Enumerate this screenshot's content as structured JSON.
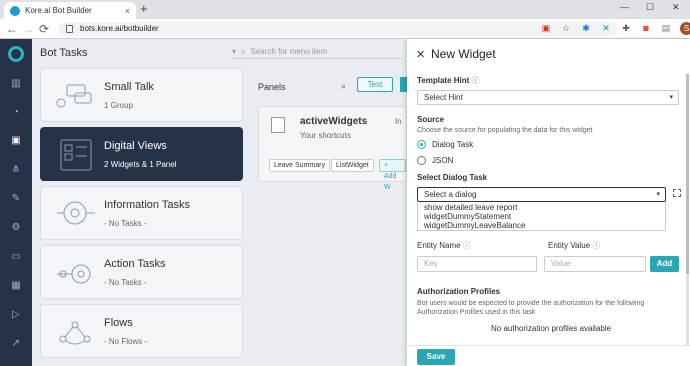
{
  "browser": {
    "tab_title": "Kore.ai Bot Builder",
    "tab_close": "×",
    "new_tab": "+",
    "url": "bots.kore.ai/botbuilder",
    "avatar_letter": "S",
    "back": "←",
    "forward": "→",
    "reload": "⟳",
    "menu": "⋮",
    "minimize": "—",
    "maximize": "☐",
    "close": "✕"
  },
  "main": {
    "title": "Bot Tasks",
    "search_placeholder": "Search for menu item",
    "cards": [
      {
        "title": "Small Talk",
        "subtitle": "1 Group"
      },
      {
        "title": "Digital Views",
        "subtitle": "2 Widgets & 1 Panel"
      },
      {
        "title": "Information Tasks",
        "subtitle": "- No Tasks -"
      },
      {
        "title": "Action Tasks",
        "subtitle": "- No Tasks -"
      },
      {
        "title": "Flows",
        "subtitle": "- No Flows -"
      }
    ],
    "panels_label": "Panels",
    "test_label": "Test",
    "panel_card": {
      "title": "activeWidgets",
      "subtitle": "Your shortcuts",
      "fragment": "In",
      "tags": [
        "Leave Summary",
        "ListWidget",
        "+ Add W"
      ]
    }
  },
  "widget": {
    "title": "New Widget",
    "template_hint_label": "Template Hint",
    "template_hint_value": "Select Hint",
    "source_label": "Source",
    "source_desc": "Choose the source for populating the data for this widget",
    "source_options": [
      "Dialog Task",
      "JSON"
    ],
    "dialog_label": "Select Dialog Task",
    "dialog_value": "Select a dialog",
    "dialog_options": [
      "show detailed leave report",
      "widgetDummyStatement",
      "widgetDummyLeaveBalance"
    ],
    "entity_name_label": "Entity Name",
    "entity_value_label": "Entity Value",
    "key_placeholder": "Key",
    "value_placeholder": "Value",
    "add_label": "Add",
    "auth_label": "Authorization Profiles",
    "auth_desc": "Bot users would be expected to provide the authorization for the following Authorization Profiles used in this task",
    "no_profiles": "No authorization profiles available",
    "save_label": "Save"
  },
  "colors": {
    "accent": "#2aa6b4",
    "sidebar": "#253248"
  }
}
